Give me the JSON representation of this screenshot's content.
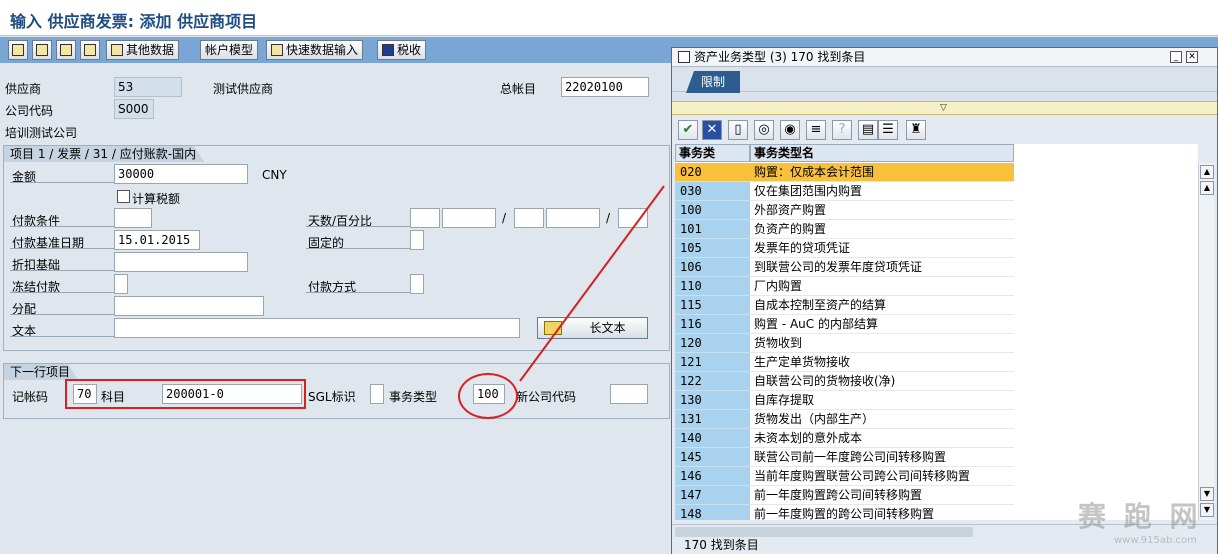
{
  "window": {
    "title": "输入 供应商发票: 添加 供应商项目"
  },
  "toolbar": {
    "other_data": "其他数据",
    "account_model": "帐户模型",
    "fast_entry": "快速数据输入",
    "tax": "税收"
  },
  "header": {
    "vendor_label": "供应商",
    "vendor_value": "53",
    "vendor_name": "测试供应商",
    "gl_label": "总帐目",
    "gl_value": "22020100",
    "company_label": "公司代码",
    "company_value": "S000",
    "company_name": "培训测试公司"
  },
  "item_group": {
    "title": "项目 1 / 发票 / 31 / 应付账款-国内",
    "amount_label": "金额",
    "amount_value": "30000",
    "currency": "CNY",
    "calc_tax_label": "计算税额",
    "payment_terms_label": "付款条件",
    "days_percent_label": "天数/百分比",
    "slash": "/",
    "baseline_label": "付款基准日期",
    "baseline_value": "15.01.2015",
    "fixed_label": "固定的",
    "discount_base_label": "折扣基础",
    "block_label": "冻结付款",
    "payment_method_label": "付款方式",
    "assignment_label": "分配",
    "text_label": "文本",
    "long_text_button": "长文本"
  },
  "next_item": {
    "title": "下一行项目",
    "posting_key_label": "记帐码",
    "posting_key_value": "70",
    "account_label": "科目",
    "account_value": "200001-0",
    "sgl_label": "SGL标识",
    "trans_type_label": "事务类型",
    "trans_type_value": "100",
    "new_company_label": "新公司代码"
  },
  "popup": {
    "title": "资产业务类型 (3)  170 找到条目",
    "restrict_tab": "限制",
    "col1": "事务类",
    "col2": "事务类型名",
    "rows": [
      {
        "code": "020",
        "name": "购置：仅成本会计范围"
      },
      {
        "code": "030",
        "name": "仅在集团范围内购置"
      },
      {
        "code": "100",
        "name": "外部资产购置"
      },
      {
        "code": "101",
        "name": "负资产的购置"
      },
      {
        "code": "105",
        "name": "发票年的贷项凭证"
      },
      {
        "code": "106",
        "name": "到联营公司的发票年度贷项凭证"
      },
      {
        "code": "110",
        "name": "厂内购置"
      },
      {
        "code": "115",
        "name": "自成本控制至资产的结算"
      },
      {
        "code": "116",
        "name": "购置 - AuC 的内部结算"
      },
      {
        "code": "120",
        "name": "货物收到"
      },
      {
        "code": "121",
        "name": "生产定单货物接收"
      },
      {
        "code": "122",
        "name": "自联营公司的货物接收(净)"
      },
      {
        "code": "130",
        "name": "自库存提取"
      },
      {
        "code": "131",
        "name": "货物发出（内部生产）"
      },
      {
        "code": "140",
        "name": "未资本划的意外成本"
      },
      {
        "code": "145",
        "name": "联营公司前一年度跨公司间转移购置"
      },
      {
        "code": "146",
        "name": "当前年度购置联营公司跨公司间转移购置"
      },
      {
        "code": "147",
        "name": "前一年度购置跨公司间转移购置"
      },
      {
        "code": "148",
        "name": "前一年度购置的跨公司间转移购置"
      }
    ],
    "status": "170 找到条目"
  },
  "watermark": {
    "text": "赛 跑 网",
    "url": "www.915ab.com"
  }
}
